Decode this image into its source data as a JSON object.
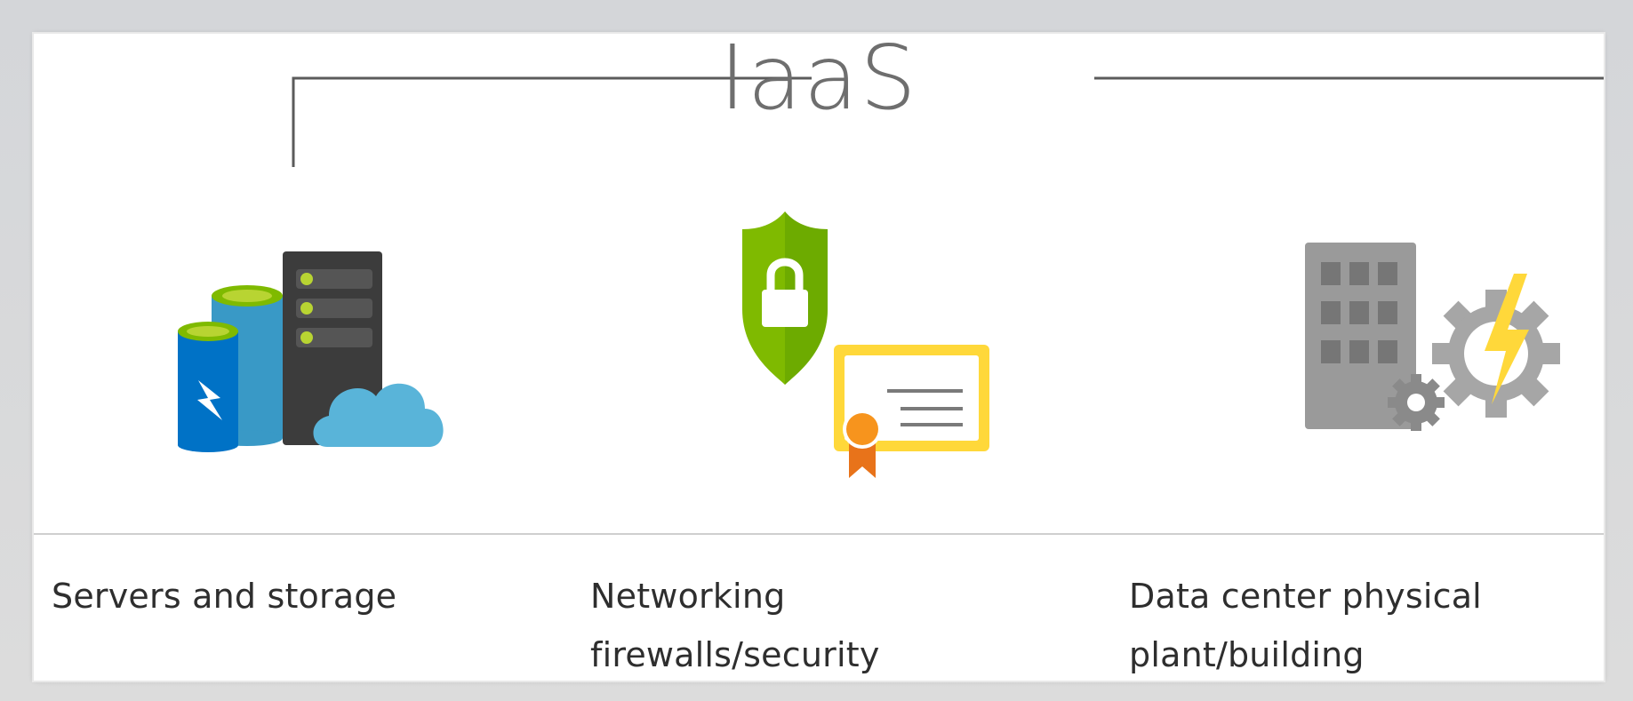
{
  "diagram": {
    "title": "IaaS",
    "items": [
      {
        "icon": "servers-storage-icon",
        "lines": [
          "Servers and storage"
        ]
      },
      {
        "icon": "networking-security-icon",
        "lines": [
          "Networking",
          "firewalls/security"
        ]
      },
      {
        "icon": "datacenter-building-icon",
        "lines": [
          "Data center physical",
          "plant/building"
        ]
      }
    ]
  },
  "colors": {
    "accent_green": "#7fba00",
    "azure_blue": "#0072c6",
    "cert_yellow": "#ffd83a",
    "server_dark": "#3c3c3c",
    "building_gray": "#9a9a9a"
  }
}
